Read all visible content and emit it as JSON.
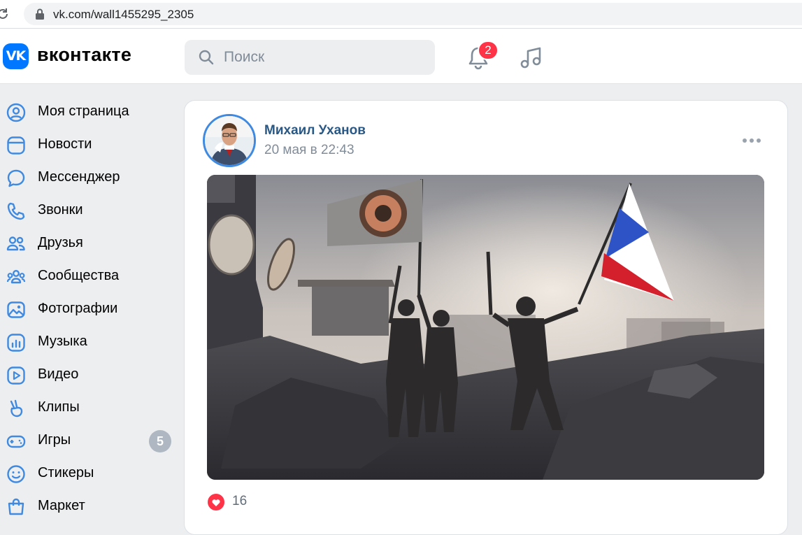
{
  "browser": {
    "url": "vk.com/wall1455295_2305"
  },
  "header": {
    "logo_text": "VK",
    "wordmark": "вконтакте",
    "search_placeholder": "Поиск",
    "notifications_count": "2",
    "accent_color": "#0077ff"
  },
  "sidebar": {
    "items": [
      {
        "label": "Моя страница",
        "icon": "profile-icon"
      },
      {
        "label": "Новости",
        "icon": "news-icon"
      },
      {
        "label": "Мессенджер",
        "icon": "messenger-icon"
      },
      {
        "label": "Звонки",
        "icon": "phone-icon"
      },
      {
        "label": "Друзья",
        "icon": "friends-icon"
      },
      {
        "label": "Сообщества",
        "icon": "communities-icon"
      },
      {
        "label": "Фотографии",
        "icon": "photos-icon"
      },
      {
        "label": "Музыка",
        "icon": "music-icon"
      },
      {
        "label": "Видео",
        "icon": "video-icon"
      },
      {
        "label": "Клипы",
        "icon": "clips-icon"
      },
      {
        "label": "Игры",
        "icon": "games-icon",
        "counter": "5"
      },
      {
        "label": "Стикеры",
        "icon": "stickers-icon"
      },
      {
        "label": "Маркет",
        "icon": "market-icon"
      }
    ]
  },
  "post": {
    "author": "Михаил Уханов",
    "date": "20 мая в 22:43",
    "likes": "16",
    "link_color": "#2a5885"
  }
}
